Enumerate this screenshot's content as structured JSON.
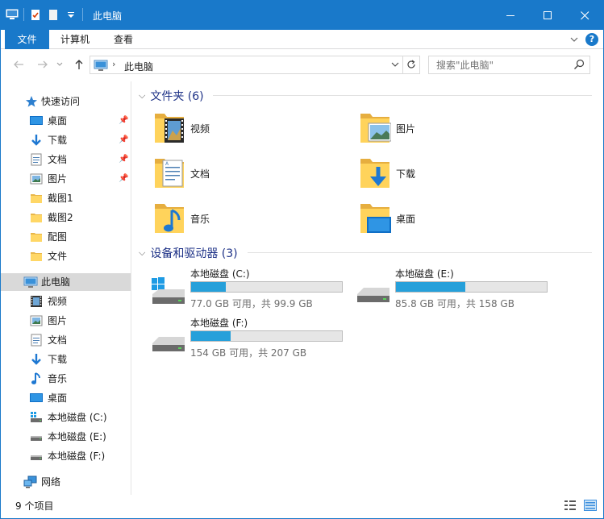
{
  "window": {
    "title": "此电脑",
    "controls": {
      "minimize": "—",
      "maximize": "☐",
      "close": "✕"
    }
  },
  "ribbon": {
    "tabs": [
      {
        "label": "文件",
        "active": true
      },
      {
        "label": "计算机",
        "active": false
      },
      {
        "label": "查看",
        "active": false
      }
    ],
    "accent": "#1979ca"
  },
  "address": {
    "path": "此电脑",
    "search_placeholder": "搜索\"此电脑\""
  },
  "sidebar": {
    "quick_access": {
      "label": "快速访问"
    },
    "pinned": [
      {
        "label": "桌面",
        "icon": "desktop-icon",
        "pinned": true
      },
      {
        "label": "下载",
        "icon": "download-icon",
        "pinned": true
      },
      {
        "label": "文档",
        "icon": "document-icon",
        "pinned": true
      },
      {
        "label": "图片",
        "icon": "picture-icon",
        "pinned": true
      },
      {
        "label": "截图1",
        "icon": "folder-icon",
        "pinned": false
      },
      {
        "label": "截图2",
        "icon": "folder-icon",
        "pinned": false
      },
      {
        "label": "配图",
        "icon": "folder-icon",
        "pinned": false
      },
      {
        "label": "文件",
        "icon": "folder-icon",
        "pinned": false
      }
    ],
    "this_pc": {
      "label": "此电脑"
    },
    "pc_items": [
      {
        "label": "视频",
        "icon": "video-icon"
      },
      {
        "label": "图片",
        "icon": "picture-icon"
      },
      {
        "label": "文档",
        "icon": "document-icon"
      },
      {
        "label": "下载",
        "icon": "download-icon"
      },
      {
        "label": "音乐",
        "icon": "music-icon"
      },
      {
        "label": "桌面",
        "icon": "desktop-icon"
      },
      {
        "label": "本地磁盘 (C:)",
        "icon": "system-drive-icon"
      },
      {
        "label": "本地磁盘 (E:)",
        "icon": "drive-icon"
      },
      {
        "label": "本地磁盘 (F:)",
        "icon": "drive-icon"
      }
    ],
    "network": {
      "label": "网络"
    }
  },
  "main": {
    "folders_header": "文件夹 (6)",
    "folders": [
      {
        "label": "视频",
        "icon": "video-folder-icon"
      },
      {
        "label": "图片",
        "icon": "picture-folder-icon"
      },
      {
        "label": "文档",
        "icon": "document-folder-icon"
      },
      {
        "label": "下载",
        "icon": "download-folder-icon"
      },
      {
        "label": "音乐",
        "icon": "music-folder-icon"
      },
      {
        "label": "桌面",
        "icon": "desktop-folder-icon"
      }
    ],
    "drives_header": "设备和驱动器 (3)",
    "drives": [
      {
        "name": "本地磁盘 (C:)",
        "space": "77.0 GB 可用，共 99.9 GB",
        "used_fraction": 0.23,
        "icon": "system-drive-icon"
      },
      {
        "name": "本地磁盘 (E:)",
        "space": "85.8 GB 可用，共 158 GB",
        "used_fraction": 0.46,
        "icon": "drive-icon"
      },
      {
        "name": "本地磁盘 (F:)",
        "space": "154 GB 可用，共 207 GB",
        "used_fraction": 0.26,
        "icon": "drive-icon"
      }
    ]
  },
  "status": {
    "count": "9 个项目"
  }
}
